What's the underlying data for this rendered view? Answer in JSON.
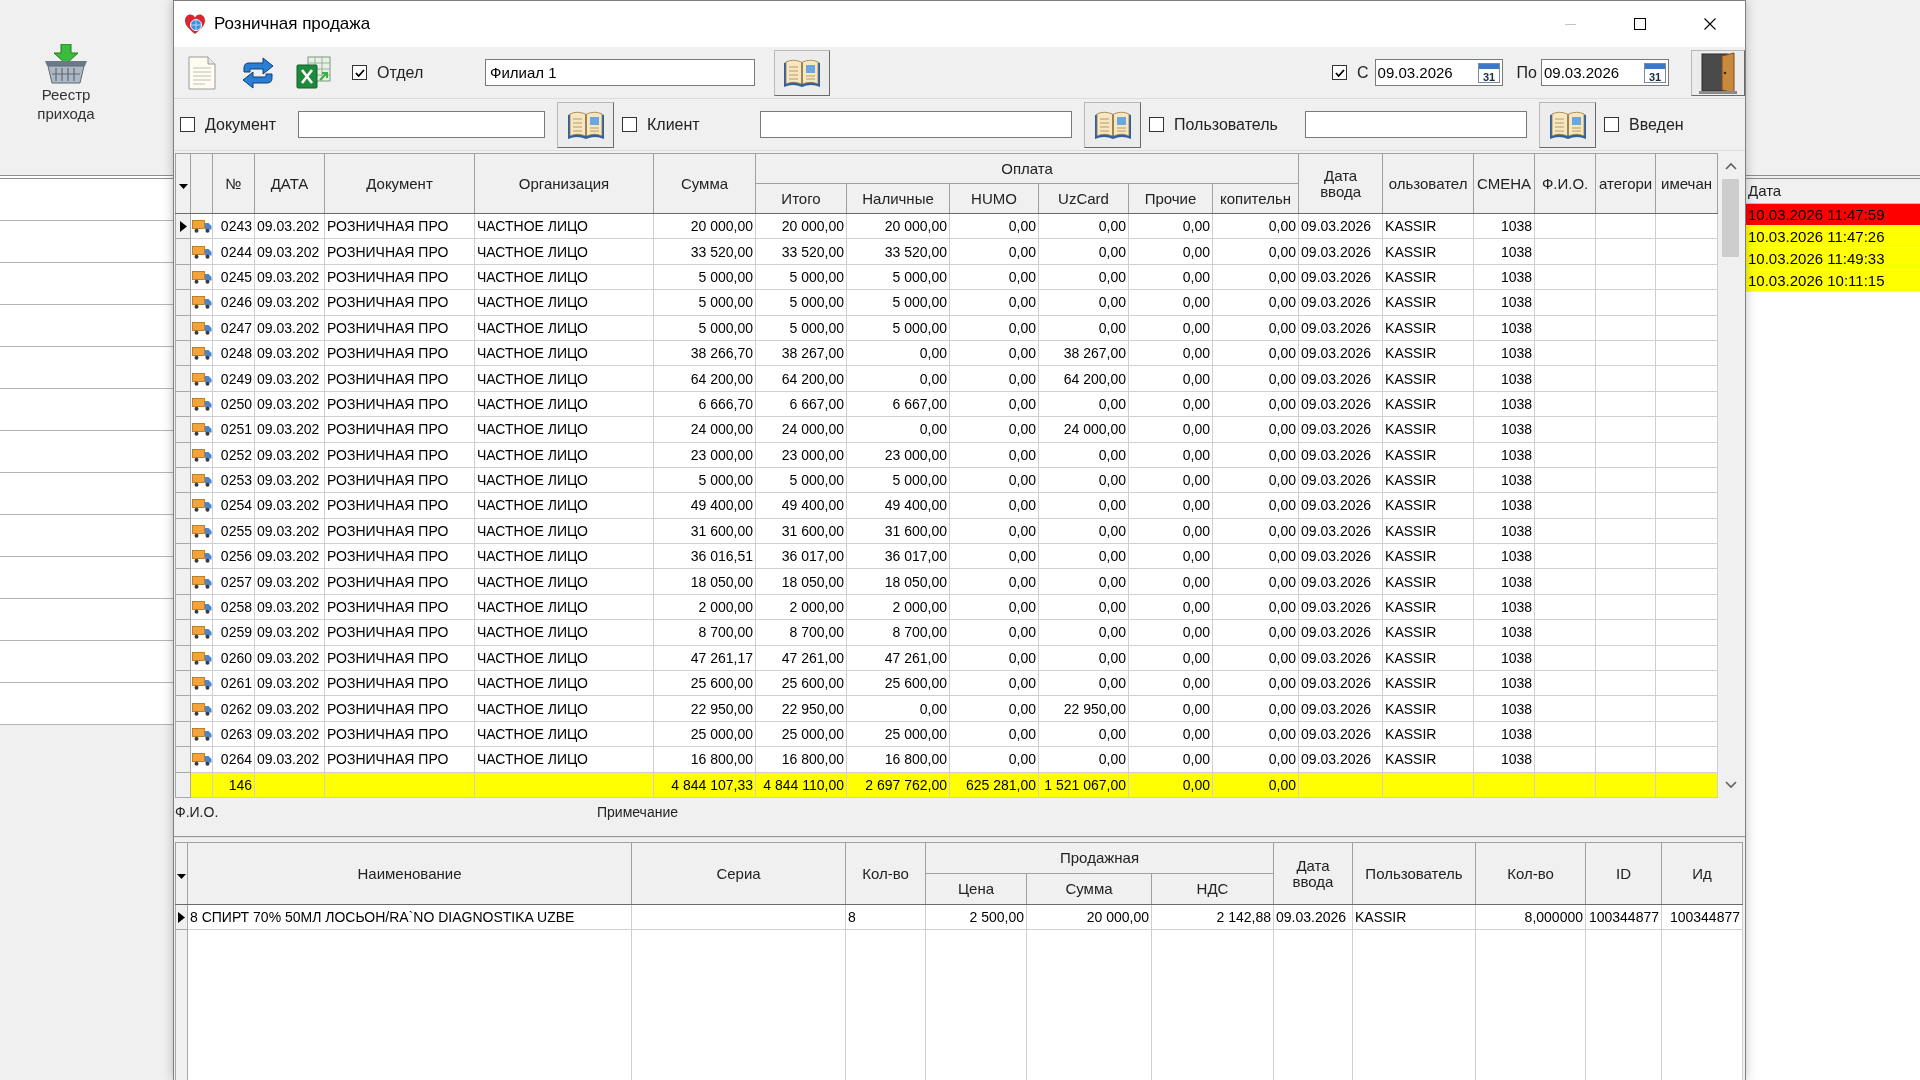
{
  "launcher": {
    "label": "Реестр прихода"
  },
  "window": {
    "title": "Розничная продажа",
    "controls": [
      {
        "kind": "minimize",
        "disabled": true
      },
      {
        "kind": "maximize",
        "disabled": false
      },
      {
        "kind": "close",
        "disabled": false
      }
    ]
  },
  "toolbar": {
    "department": {
      "label": "Отдел",
      "checked": true,
      "value": "Филиал 1"
    },
    "date_from": {
      "label": "С",
      "checked": true,
      "value": "09.03.2026",
      "calendar": "31"
    },
    "date_to": {
      "label": "По",
      "value": "09.03.2026",
      "calendar": "31"
    }
  },
  "filters": [
    {
      "kind": "lookup",
      "label": "Документ",
      "checked": false
    },
    {
      "kind": "lookup",
      "label": "Клиент",
      "checked": false
    },
    {
      "kind": "lookup",
      "label": "Пользователь",
      "checked": false
    },
    {
      "kind": "checkbox",
      "label": "Введен",
      "checked": false
    }
  ],
  "grid": {
    "column_group": {
      "label": "Оплата"
    },
    "columns": [
      {
        "label": "№",
        "grouped": false
      },
      {
        "label": "ДАТА",
        "grouped": false
      },
      {
        "label": "Документ",
        "grouped": false
      },
      {
        "label": "Организация",
        "grouped": false
      },
      {
        "label": "Сумма",
        "grouped": false
      },
      {
        "label": "Итого",
        "grouped": true
      },
      {
        "label": "Наличные",
        "grouped": true
      },
      {
        "label": "HUMO",
        "grouped": true
      },
      {
        "label": "UzCard",
        "grouped": true
      },
      {
        "label": "Прочие",
        "grouped": true
      },
      {
        "label": "копительн",
        "grouped": true
      },
      {
        "label": "Дата ввода",
        "grouped": false
      },
      {
        "label": "ользовател",
        "grouped": false
      },
      {
        "label": "СМЕНА",
        "grouped": false
      },
      {
        "label": "Ф.И.О.",
        "grouped": false
      },
      {
        "label": "атегори",
        "grouped": false
      },
      {
        "label": "имечан",
        "grouped": false
      }
    ],
    "rows": [
      {
        "selected": true,
        "cells": [
          "0243",
          "09.03.202",
          "РОЗНИЧНАЯ ПРО",
          "ЧАСТНОЕ ЛИЦО",
          "20 000,00",
          "20 000,00",
          "20 000,00",
          "0,00",
          "0,00",
          "0,00",
          "0,00",
          "09.03.2026",
          "KASSIR",
          "1038"
        ]
      },
      {
        "selected": false,
        "cells": [
          "0244",
          "09.03.202",
          "РОЗНИЧНАЯ ПРО",
          "ЧАСТНОЕ ЛИЦО",
          "33 520,00",
          "33 520,00",
          "33 520,00",
          "0,00",
          "0,00",
          "0,00",
          "0,00",
          "09.03.2026",
          "KASSIR",
          "1038"
        ]
      },
      {
        "selected": false,
        "cells": [
          "0245",
          "09.03.202",
          "РОЗНИЧНАЯ ПРО",
          "ЧАСТНОЕ ЛИЦО",
          "5 000,00",
          "5 000,00",
          "5 000,00",
          "0,00",
          "0,00",
          "0,00",
          "0,00",
          "09.03.2026",
          "KASSIR",
          "1038"
        ]
      },
      {
        "selected": false,
        "cells": [
          "0246",
          "09.03.202",
          "РОЗНИЧНАЯ ПРО",
          "ЧАСТНОЕ ЛИЦО",
          "5 000,00",
          "5 000,00",
          "5 000,00",
          "0,00",
          "0,00",
          "0,00",
          "0,00",
          "09.03.2026",
          "KASSIR",
          "1038"
        ]
      },
      {
        "selected": false,
        "cells": [
          "0247",
          "09.03.202",
          "РОЗНИЧНАЯ ПРО",
          "ЧАСТНОЕ ЛИЦО",
          "5 000,00",
          "5 000,00",
          "5 000,00",
          "0,00",
          "0,00",
          "0,00",
          "0,00",
          "09.03.2026",
          "KASSIR",
          "1038"
        ]
      },
      {
        "selected": false,
        "cells": [
          "0248",
          "09.03.202",
          "РОЗНИЧНАЯ ПРО",
          "ЧАСТНОЕ ЛИЦО",
          "38 266,70",
          "38 267,00",
          "0,00",
          "0,00",
          "38 267,00",
          "0,00",
          "0,00",
          "09.03.2026",
          "KASSIR",
          "1038"
        ]
      },
      {
        "selected": false,
        "cells": [
          "0249",
          "09.03.202",
          "РОЗНИЧНАЯ ПРО",
          "ЧАСТНОЕ ЛИЦО",
          "64 200,00",
          "64 200,00",
          "0,00",
          "0,00",
          "64 200,00",
          "0,00",
          "0,00",
          "09.03.2026",
          "KASSIR",
          "1038"
        ]
      },
      {
        "selected": false,
        "cells": [
          "0250",
          "09.03.202",
          "РОЗНИЧНАЯ ПРО",
          "ЧАСТНОЕ ЛИЦО",
          "6 666,70",
          "6 667,00",
          "6 667,00",
          "0,00",
          "0,00",
          "0,00",
          "0,00",
          "09.03.2026",
          "KASSIR",
          "1038"
        ]
      },
      {
        "selected": false,
        "cells": [
          "0251",
          "09.03.202",
          "РОЗНИЧНАЯ ПРО",
          "ЧАСТНОЕ ЛИЦО",
          "24 000,00",
          "24 000,00",
          "0,00",
          "0,00",
          "24 000,00",
          "0,00",
          "0,00",
          "09.03.2026",
          "KASSIR",
          "1038"
        ]
      },
      {
        "selected": false,
        "cells": [
          "0252",
          "09.03.202",
          "РОЗНИЧНАЯ ПРО",
          "ЧАСТНОЕ ЛИЦО",
          "23 000,00",
          "23 000,00",
          "23 000,00",
          "0,00",
          "0,00",
          "0,00",
          "0,00",
          "09.03.2026",
          "KASSIR",
          "1038"
        ]
      },
      {
        "selected": false,
        "cells": [
          "0253",
          "09.03.202",
          "РОЗНИЧНАЯ ПРО",
          "ЧАСТНОЕ ЛИЦО",
          "5 000,00",
          "5 000,00",
          "5 000,00",
          "0,00",
          "0,00",
          "0,00",
          "0,00",
          "09.03.2026",
          "KASSIR",
          "1038"
        ]
      },
      {
        "selected": false,
        "cells": [
          "0254",
          "09.03.202",
          "РОЗНИЧНАЯ ПРО",
          "ЧАСТНОЕ ЛИЦО",
          "49 400,00",
          "49 400,00",
          "49 400,00",
          "0,00",
          "0,00",
          "0,00",
          "0,00",
          "09.03.2026",
          "KASSIR",
          "1038"
        ]
      },
      {
        "selected": false,
        "cells": [
          "0255",
          "09.03.202",
          "РОЗНИЧНАЯ ПРО",
          "ЧАСТНОЕ ЛИЦО",
          "31 600,00",
          "31 600,00",
          "31 600,00",
          "0,00",
          "0,00",
          "0,00",
          "0,00",
          "09.03.2026",
          "KASSIR",
          "1038"
        ]
      },
      {
        "selected": false,
        "cells": [
          "0256",
          "09.03.202",
          "РОЗНИЧНАЯ ПРО",
          "ЧАСТНОЕ ЛИЦО",
          "36 016,51",
          "36 017,00",
          "36 017,00",
          "0,00",
          "0,00",
          "0,00",
          "0,00",
          "09.03.2026",
          "KASSIR",
          "1038"
        ]
      },
      {
        "selected": false,
        "cells": [
          "0257",
          "09.03.202",
          "РОЗНИЧНАЯ ПРО",
          "ЧАСТНОЕ ЛИЦО",
          "18 050,00",
          "18 050,00",
          "18 050,00",
          "0,00",
          "0,00",
          "0,00",
          "0,00",
          "09.03.2026",
          "KASSIR",
          "1038"
        ]
      },
      {
        "selected": false,
        "cells": [
          "0258",
          "09.03.202",
          "РОЗНИЧНАЯ ПРО",
          "ЧАСТНОЕ ЛИЦО",
          "2 000,00",
          "2 000,00",
          "2 000,00",
          "0,00",
          "0,00",
          "0,00",
          "0,00",
          "09.03.2026",
          "KASSIR",
          "1038"
        ]
      },
      {
        "selected": false,
        "cells": [
          "0259",
          "09.03.202",
          "РОЗНИЧНАЯ ПРО",
          "ЧАСТНОЕ ЛИЦО",
          "8 700,00",
          "8 700,00",
          "8 700,00",
          "0,00",
          "0,00",
          "0,00",
          "0,00",
          "09.03.2026",
          "KASSIR",
          "1038"
        ]
      },
      {
        "selected": false,
        "cells": [
          "0260",
          "09.03.202",
          "РОЗНИЧНАЯ ПРО",
          "ЧАСТНОЕ ЛИЦО",
          "47 261,17",
          "47 261,00",
          "47 261,00",
          "0,00",
          "0,00",
          "0,00",
          "0,00",
          "09.03.2026",
          "KASSIR",
          "1038"
        ]
      },
      {
        "selected": false,
        "cells": [
          "0261",
          "09.03.202",
          "РОЗНИЧНАЯ ПРО",
          "ЧАСТНОЕ ЛИЦО",
          "25 600,00",
          "25 600,00",
          "25 600,00",
          "0,00",
          "0,00",
          "0,00",
          "0,00",
          "09.03.2026",
          "KASSIR",
          "1038"
        ]
      },
      {
        "selected": false,
        "cells": [
          "0262",
          "09.03.202",
          "РОЗНИЧНАЯ ПРО",
          "ЧАСТНОЕ ЛИЦО",
          "22 950,00",
          "22 950,00",
          "0,00",
          "0,00",
          "22 950,00",
          "0,00",
          "0,00",
          "09.03.2026",
          "KASSIR",
          "1038"
        ]
      },
      {
        "selected": false,
        "cells": [
          "0263",
          "09.03.202",
          "РОЗНИЧНАЯ ПРО",
          "ЧАСТНОЕ ЛИЦО",
          "25 000,00",
          "25 000,00",
          "25 000,00",
          "0,00",
          "0,00",
          "0,00",
          "0,00",
          "09.03.2026",
          "KASSIR",
          "1038"
        ]
      },
      {
        "selected": false,
        "cells": [
          "0264",
          "09.03.202",
          "РОЗНИЧНАЯ ПРО",
          "ЧАСТНОЕ ЛИЦО",
          "16 800,00",
          "16 800,00",
          "16 800,00",
          "0,00",
          "0,00",
          "0,00",
          "0,00",
          "09.03.2026",
          "KASSIR",
          "1038"
        ]
      }
    ],
    "totals": {
      "count": "146",
      "values": [
        "4 844 107,33",
        "4 844 110,00",
        "2 697 762,00",
        "625 281,00",
        "1 521 067,00",
        "0,00",
        "0,00"
      ]
    }
  },
  "details": {
    "labels": [
      "Ф.И.О.",
      "Примечание"
    ]
  },
  "items": {
    "column_group": {
      "label": "Продажная"
    },
    "columns": [
      {
        "label": "Наименование",
        "grouped": false
      },
      {
        "label": "Сериа",
        "grouped": false
      },
      {
        "label": "Кол-во",
        "grouped": false
      },
      {
        "label": "Цена",
        "grouped": true
      },
      {
        "label": "Сумма",
        "grouped": true
      },
      {
        "label": "НДС",
        "grouped": true
      },
      {
        "label": "Дата ввода",
        "grouped": false
      },
      {
        "label": "Пользователь",
        "grouped": false
      },
      {
        "label": "Кол-во",
        "grouped": false
      },
      {
        "label": "ID",
        "grouped": false
      },
      {
        "label": "Ид",
        "grouped": false
      }
    ],
    "rows": [
      {
        "selected": true,
        "name": "8 СПИРТ 70% 50МЛ ЛОСЬОН/RA`NO DIAGNOSTIKA UZBE",
        "quantity": "8",
        "price": "2 500,00",
        "amount": "20 000,00",
        "vat": "2 142,88",
        "entered": "09.03.2026",
        "user": "KASSIR",
        "quantity_base": "8,000000",
        "id": "100344877",
        "id_2": "100344877"
      }
    ]
  },
  "side_list": {
    "header": "Дата",
    "rows": [
      {
        "text": "10.03.2026 11:47:59",
        "color": "#ff0000"
      },
      {
        "text": "10.03.2026 11:47:26",
        "color": "#ffff00"
      },
      {
        "text": "10.03.2026 11:49:33",
        "color": "#ffff00"
      },
      {
        "text": "10.03.2026 10:11:15",
        "color": "#ffff00"
      }
    ]
  }
}
